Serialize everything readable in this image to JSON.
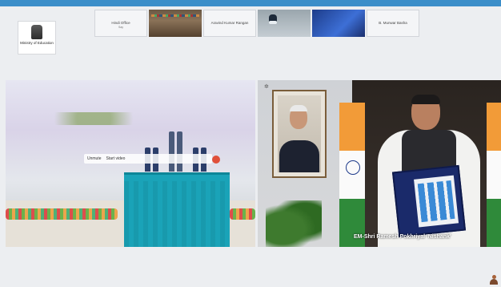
{
  "window": {
    "top_bar_title": "",
    "accent_color": "#3b8ec9"
  },
  "logo": {
    "icon": "emblem-icon",
    "text": "Ministry of Education"
  },
  "participants": [
    {
      "name": "Hindi Office",
      "sub": "Say"
    },
    {
      "name": "Aravind Kumar Rangan",
      "sub": ""
    },
    {
      "name": "B. Munwar Basha",
      "sub": ""
    }
  ],
  "thumb_poster": {
    "text": ""
  },
  "left_video": {
    "toolbar": [
      "Unmute",
      "Start video"
    ],
    "side_tag": ""
  },
  "right_video": {
    "caption": "EM-Shri Ramesh Pokhriyal 'Nishank'"
  }
}
